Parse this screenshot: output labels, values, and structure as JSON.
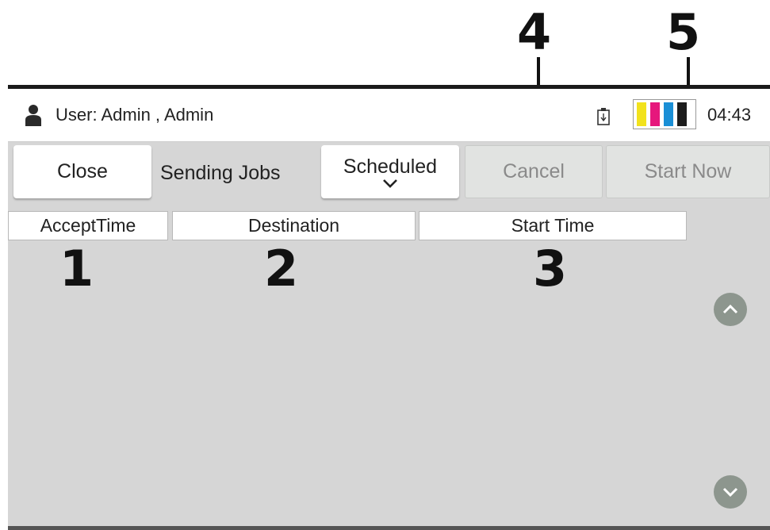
{
  "callouts": {
    "c1": "1",
    "c2": "2",
    "c3": "3",
    "c4": "4",
    "c5": "5"
  },
  "status": {
    "user": "User: Admin , Admin",
    "time": "04:43"
  },
  "toolbar": {
    "close": "Close",
    "tab_label": "Sending Jobs",
    "filter_selected": "Scheduled",
    "cancel": "Cancel",
    "start_now": "Start Now"
  },
  "table": {
    "columns": [
      "AcceptTime",
      "Destination",
      "Start Time"
    ]
  },
  "colors": {
    "toner": [
      "#f2e21c",
      "#e6177c",
      "#1a8fd6",
      "#1c1c1c"
    ],
    "panel_bg": "#d6d6d6",
    "scroll_button": "#8d968e"
  },
  "icons": [
    "user-icon",
    "storage-icon",
    "chevron-down-icon",
    "scroll-up-icon",
    "scroll-down-icon"
  ]
}
